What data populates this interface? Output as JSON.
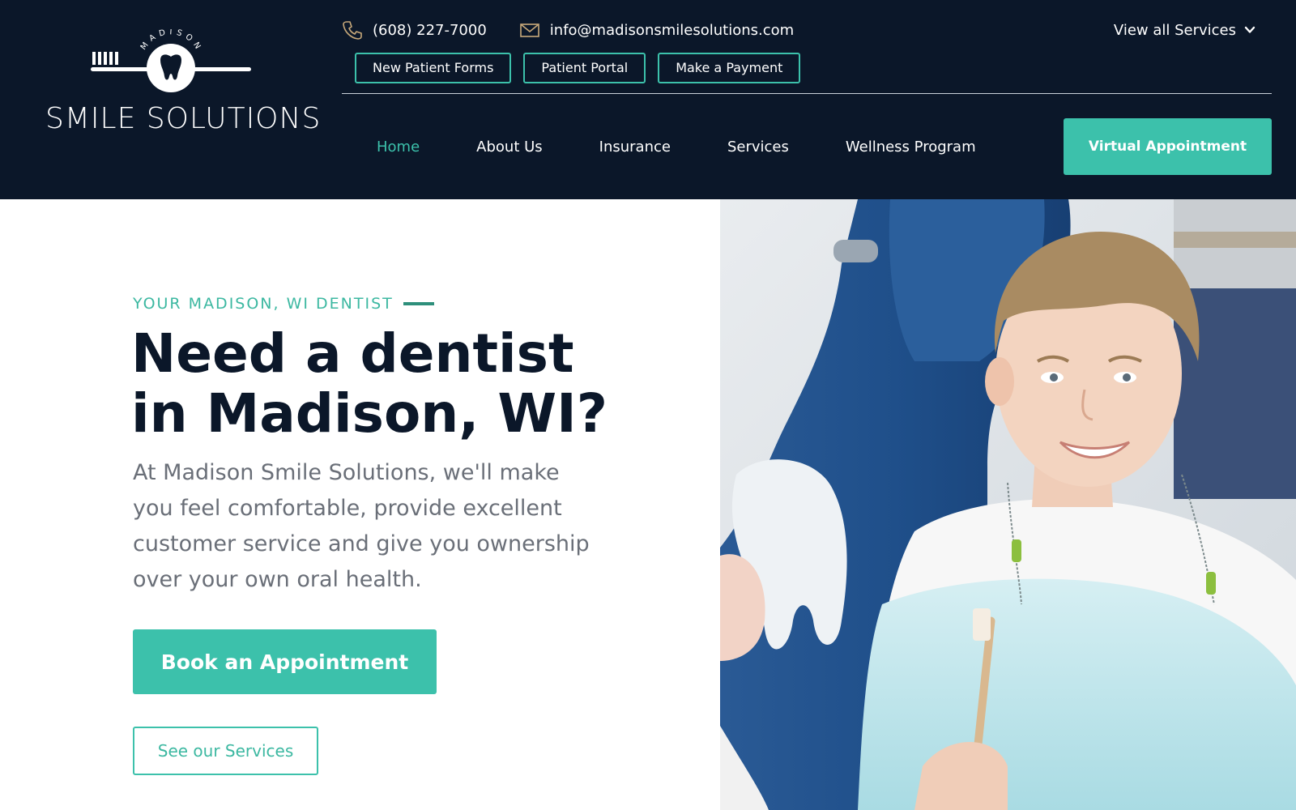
{
  "logo": {
    "arc_text": "MADISON",
    "wordmark": "SMILE SOLUTIONS"
  },
  "contact": {
    "phone": "(608) 227-7000",
    "email": "info@madisonsmilesolutions.com",
    "phone_icon": "phone-icon",
    "email_icon": "mail-icon"
  },
  "header": {
    "view_all_services": "View all Services"
  },
  "portal_links": [
    {
      "label": "New Patient Forms"
    },
    {
      "label": "Patient Portal"
    },
    {
      "label": "Make a Payment"
    }
  ],
  "nav": {
    "items": [
      {
        "label": "Home",
        "active": true
      },
      {
        "label": "About Us",
        "active": false
      },
      {
        "label": "Insurance",
        "active": false
      },
      {
        "label": "Services",
        "active": false
      },
      {
        "label": "Wellness Program",
        "active": false
      }
    ],
    "cta": "Virtual Appointment"
  },
  "hero": {
    "eyebrow": "YOUR MADISON, WI DENTIST",
    "title_line1": "Need a dentist",
    "title_line2": "in Madison, WI?",
    "body": "At Madison Smile Solutions, we'll make you feel comfortable, provide excellent customer service and give you ownership over your own oral health.",
    "primary_button": "Book an Appointment",
    "secondary_button": "See our Services"
  },
  "colors": {
    "navy": "#0b1729",
    "teal": "#3cc1ab",
    "body_gray": "#6a6f78"
  }
}
